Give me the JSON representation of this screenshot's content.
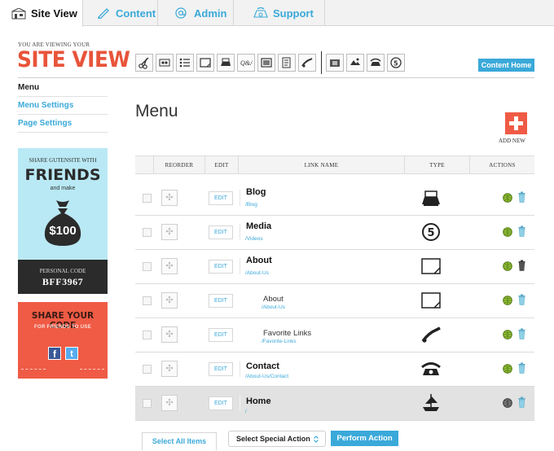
{
  "tabs": [
    {
      "label": "Site View",
      "icon": "site-view-icon"
    },
    {
      "label": "Content",
      "icon": "pencil-icon"
    },
    {
      "label": "Admin",
      "icon": "at-icon"
    },
    {
      "label": "Support",
      "icon": "support-icon"
    }
  ],
  "header": {
    "viewing_text": "YOU ARE VIEWING YOUR",
    "title": "SITE VIEW",
    "content_home_label": "Content Home",
    "toolbar_icons": [
      "scissors-icon",
      "tape-icon",
      "list-icon",
      "page-icon",
      "typewriter-icon",
      "qa-icon",
      "gallery-icon",
      "document-icon",
      "link-icon",
      "image-icon",
      "gallery-alt-icon",
      "rotary-phone-icon",
      "media-icon"
    ]
  },
  "sidebar": {
    "items": [
      {
        "label": "Menu"
      },
      {
        "label": "Menu Settings"
      },
      {
        "label": "Page Settings"
      }
    ],
    "promo_friends": {
      "share_text": "SHARE GUTENSITE WITH",
      "headline": "FRIENDS",
      "subtext": "and make",
      "amount": "$100",
      "code_label": "PERSONAL CODE",
      "code": "BFF3967"
    },
    "promo_share": {
      "headline": "SHARE YOUR CODE",
      "subtext": "FOR FRIENDS TO USE"
    }
  },
  "main": {
    "title": "Menu",
    "add_new_label": "ADD NEW",
    "columns": [
      "REORDER",
      "EDIT",
      "LINK NAME",
      "TYPE",
      "ACTIONS"
    ],
    "edit_label": "EDIT",
    "rows": [
      {
        "name": "Blog",
        "url": "/Blog",
        "type_icon": "typewriter-icon",
        "level": 0
      },
      {
        "name": "Media",
        "url": "/Videos",
        "type_icon": "media-icon",
        "level": 0
      },
      {
        "name": "About",
        "url": "/About-Us",
        "type_icon": "page-icon",
        "level": 0
      },
      {
        "name": "About",
        "url": "/About-Us",
        "type_icon": "page-icon",
        "level": 1
      },
      {
        "name": "Favorite Links",
        "url": "/Favorite-Links",
        "type_icon": "link-icon",
        "level": 1
      },
      {
        "name": "Contact",
        "url": "/About-Us/Contact",
        "type_icon": "rotary-phone-icon",
        "level": 0
      },
      {
        "name": "Home",
        "url": "/",
        "type_icon": "ship-icon",
        "level": 0
      }
    ],
    "select_all_label": "Select All Items",
    "special_action_value": "Select Special Action",
    "perform_action_label": "Perform Action"
  }
}
